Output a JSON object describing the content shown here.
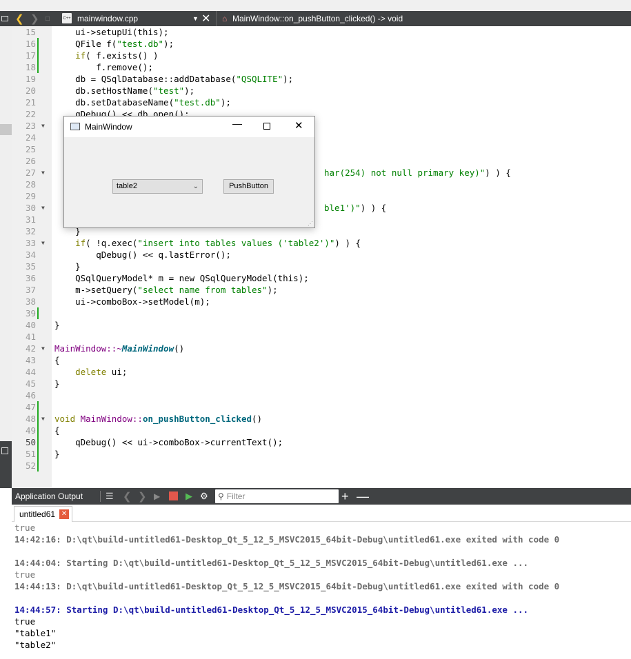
{
  "editor_toolbar": {
    "file_name": "mainwindow.cpp",
    "file_icon_text": "C++",
    "symbol": "MainWindow::on_pushButton_clicked() -> void"
  },
  "line_numbers": [
    "15",
    "16",
    "17",
    "18",
    "19",
    "20",
    "21",
    "22",
    "23",
    "24",
    "25",
    "26",
    "27",
    "28",
    "29",
    "30",
    "31",
    "32",
    "33",
    "34",
    "35",
    "36",
    "37",
    "38",
    "39",
    "40",
    "41",
    "42",
    "43",
    "44",
    "45",
    "46",
    "47",
    "48",
    "49",
    "50",
    "51",
    "52"
  ],
  "code_lines": {
    "l15": "    ui->setupUi(this);",
    "l16_a": "    QFile f(",
    "l16_s": "\"test.db\"",
    "l16_b": ");",
    "l17_k": "    if",
    "l17_b": "( f.exists() )",
    "l18": "        f.remove();",
    "l19_a": "    db = QSqlDatabase::addDatabase(",
    "l19_s": "\"QSQLITE\"",
    "l19_b": ");",
    "l20_a": "    db.setHostName(",
    "l20_s": "\"test\"",
    "l20_b": ");",
    "l21_a": "    db.setDatabaseName(",
    "l21_s": "\"test.db\"",
    "l21_b": ");",
    "l22": "    qDebug() << db.open();",
    "l27_s": "har(254) not null primary key)\"",
    "l27_b": ") ) {",
    "l30_s": "ble1')\"",
    "l30_b": ") ) {",
    "l32": "    }",
    "l33_k": "    if",
    "l33_a": "( !q.exec(",
    "l33_s": "\"insert into tables values ('table2')\"",
    "l33_b": ") ) {",
    "l34": "        qDebug() << q.lastError();",
    "l35": "    }",
    "l36": "    QSqlQueryModel* m = new QSqlQueryModel(this);",
    "l37_a": "    m->setQuery(",
    "l37_s": "\"select name from tables\"",
    "l37_b": ");",
    "l38": "    ui->comboBox->setModel(m);",
    "l40": "}",
    "l42_a": "MainWindow::~",
    "l42_it": "MainWindow",
    "l42_b": "()",
    "l43": "{",
    "l44_k": "    delete",
    "l44_b": " ui;",
    "l45": "}",
    "l48_k": "void",
    "l48_a": " MainWindow::",
    "l48_fn": "on_pushButton_clicked",
    "l48_b": "()",
    "l49": "{",
    "l50": "    qDebug() << ui->comboBox->currentText();",
    "l51": "}"
  },
  "app_window": {
    "title": "MainWindow",
    "combo_value": "table2",
    "button_label": "PushButton"
  },
  "output_panel": {
    "title": "Application Output",
    "filter_placeholder": "Filter",
    "tab_label": "untitled61",
    "lines": [
      "true",
      "14:42:16: D:\\qt\\build-untitled61-Desktop_Qt_5_12_5_MSVC2015_64bit-Debug\\untitled61.exe exited with code 0",
      "",
      "14:44:04: Starting D:\\qt\\build-untitled61-Desktop_Qt_5_12_5_MSVC2015_64bit-Debug\\untitled61.exe ...",
      "true",
      "14:44:13: D:\\qt\\build-untitled61-Desktop_Qt_5_12_5_MSVC2015_64bit-Debug\\untitled61.exe exited with code 0",
      "",
      "14:44:57: Starting D:\\qt\\build-untitled61-Desktop_Qt_5_12_5_MSVC2015_64bit-Debug\\untitled61.exe ...",
      "true",
      "\"table1\"",
      "\"table2\""
    ]
  },
  "colors": {
    "toolbar_bg": "#404244",
    "keyword": "#808000",
    "string": "#008000",
    "type": "#800080",
    "start_line": "#1a1aa6",
    "stop_button": "#e2574c"
  }
}
